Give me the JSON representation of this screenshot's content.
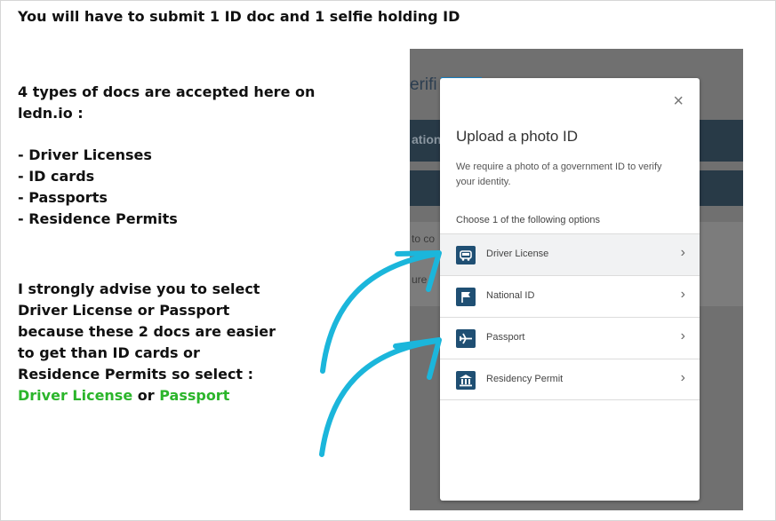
{
  "instructions": {
    "heading": "You will have to submit 1 ID doc and 1 selfie holding ID",
    "types_intro_line1": "4 types of docs are accepted here on",
    "types_intro_line2": "ledn.io :",
    "doc_types": [
      "- Driver Licenses",
      "- ID cards",
      "- Passports",
      "- Residence Permits"
    ],
    "advice_lines": [
      "I strongly advise you to select",
      "Driver License or Passport",
      "because these 2 docs are easier",
      "to get than ID cards or",
      "Residence Permits so select :"
    ],
    "recommend_1": "Driver License",
    "recommend_join": " or ",
    "recommend_2": "Passport"
  },
  "background_page": {
    "title_fragment": "erifi",
    "band_fragment": "ation",
    "line_fragments": [
      "to co",
      "",
      "ure"
    ]
  },
  "modal": {
    "title": "Upload a photo ID",
    "description": "We require a photo of a government ID to verify your identity.",
    "choose_label": "Choose 1 of the following options",
    "close_glyph": "×",
    "options": [
      {
        "label": "Driver License",
        "icon": "car-icon",
        "chevron": "›"
      },
      {
        "label": "National ID",
        "icon": "flag-icon",
        "chevron": "›"
      },
      {
        "label": "Passport",
        "icon": "airplane-icon",
        "chevron": "›"
      },
      {
        "label": "Residency Permit",
        "icon": "building-icon",
        "chevron": "›"
      }
    ]
  },
  "colors": {
    "recommend": "#2bb52b",
    "arrow": "#1bb6db",
    "icon_bg": "#1f4f73"
  }
}
